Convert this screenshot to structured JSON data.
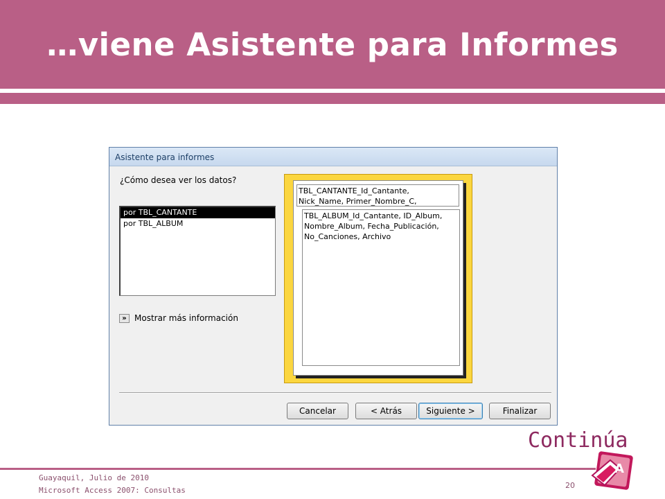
{
  "slide": {
    "title": "…viene Asistente para Informes",
    "continue_label": "Continúa",
    "footer_line1": "Guayaquil, Julio de 2010",
    "footer_line2": "Microsoft Access 2007: Consultas",
    "page_number": "20"
  },
  "dialog": {
    "title": "Asistente para informes",
    "question": "¿Cómo desea ver los datos?",
    "list_items": [
      {
        "label": "por TBL_CANTANTE",
        "selected": true
      },
      {
        "label": "por TBL_ALBUM",
        "selected": false
      }
    ],
    "more_info": {
      "icon": "chevron-double-right-icon",
      "label": "Mostrar más información"
    },
    "preview": {
      "header_lines": [
        "TBL_CANTANTE_Id_Cantante,",
        "Nick_Name, Primer_Nombre_C,"
      ],
      "detail_lines": [
        "TBL_ALBUM_Id_Cantante, ID_Album,",
        "Nombre_Album, Fecha_Publicación,",
        "No_Canciones, Archivo"
      ]
    },
    "buttons": {
      "cancel": "Cancelar",
      "back": "< Atrás",
      "next": "Siguiente >",
      "finish": "Finalizar"
    }
  },
  "colors": {
    "slide_accent": "#b95f86",
    "continue_text": "#8e2a60",
    "preview_frame": "#fbd63f",
    "selection": "#000000"
  }
}
